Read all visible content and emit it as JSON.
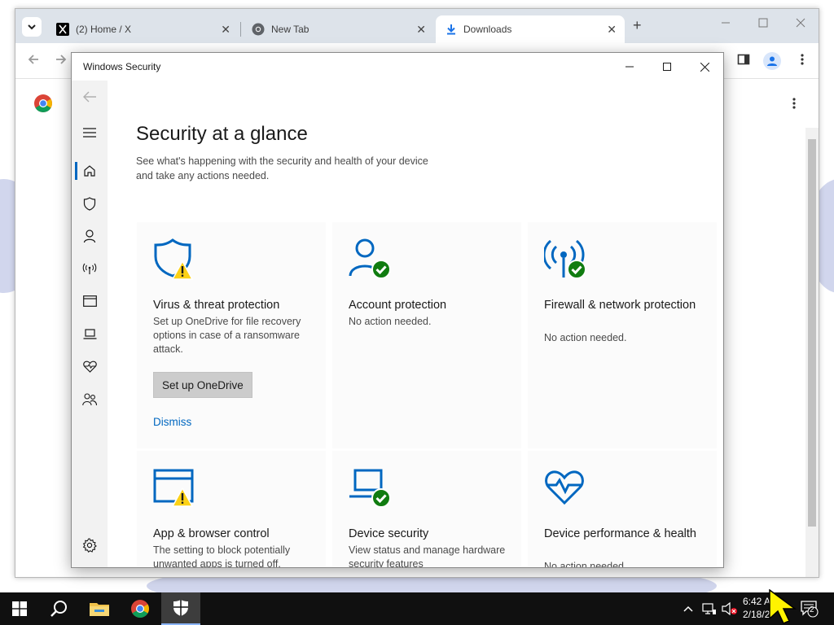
{
  "browser": {
    "tabs": [
      {
        "title": "(2) Home / X",
        "icon": "x-logo-icon"
      },
      {
        "title": "New Tab",
        "icon": "chrome-icon"
      },
      {
        "title": "Downloads",
        "icon": "download-icon"
      }
    ],
    "new_tab": "+",
    "close": "✕"
  },
  "dialog": {
    "title": "Windows Security",
    "heading": "Security at a glance",
    "subtitle": "See what's happening with the security and health of your device and take any actions needed.",
    "cards": [
      {
        "title": "Virus & threat protection",
        "description": "Set up OneDrive for file recovery options in case of a ransomware attack.",
        "button": "Set up OneDrive",
        "link": "Dismiss",
        "status": "warning"
      },
      {
        "title": "Account protection",
        "description": "No action needed.",
        "status": "ok"
      },
      {
        "title": "Firewall & network protection",
        "description": "No action needed.",
        "status": "ok"
      },
      {
        "title": "App & browser control",
        "description": "The setting to block potentially unwanted apps is turned off.",
        "status": "warning"
      },
      {
        "title": "Device security",
        "description": "View status and manage hardware security features",
        "status": "ok"
      },
      {
        "title": "Device performance & health",
        "description": "No action needed.",
        "status": "ok"
      }
    ]
  },
  "taskbar": {
    "time": "6:42 AM",
    "date": "2/18/2",
    "notification_count": "2"
  },
  "colors": {
    "accent": "#0067c0",
    "ok_green": "#107c10",
    "warning_yellow": "#fcd116"
  }
}
